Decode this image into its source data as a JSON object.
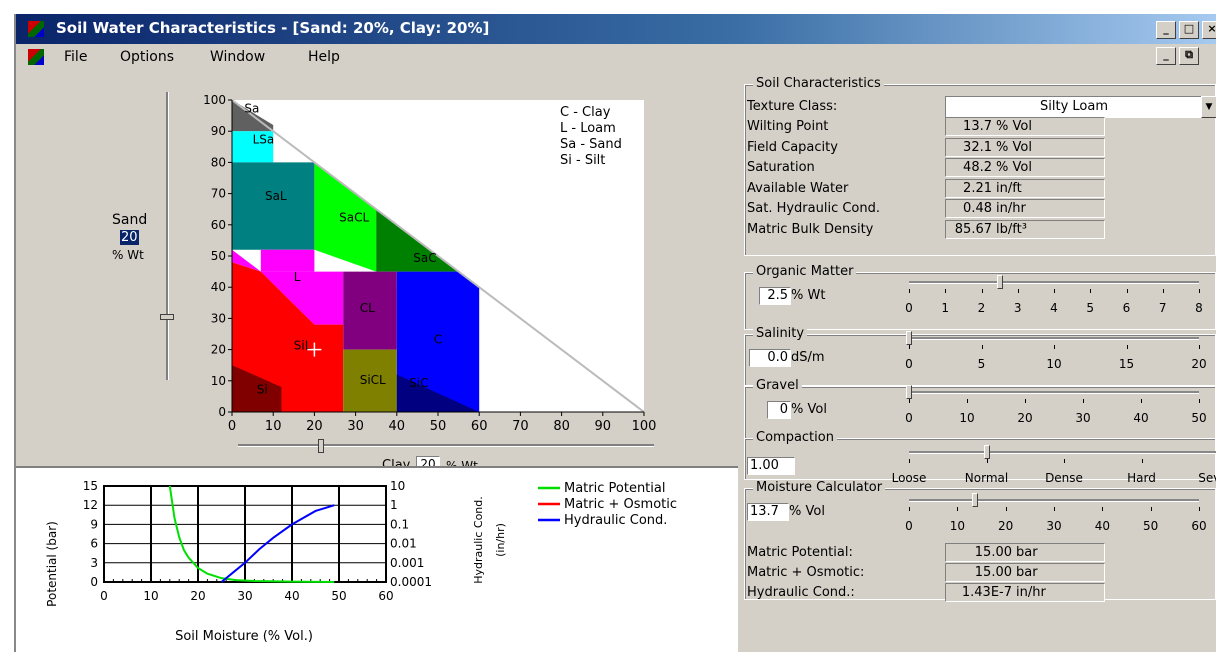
{
  "window": {
    "title": "Soil Water Characteristics  - [Sand: 20%, Clay: 20%]",
    "min": "_",
    "max": "□",
    "close": "×",
    "restore": "⧉"
  },
  "menu": [
    "File",
    "Options",
    "Window",
    "Help"
  ],
  "triangle": {
    "sand_label": "Sand",
    "sand_value": "20",
    "sand_unit": "% Wt",
    "clay_label": "Clay",
    "clay_value": "20",
    "clay_unit": "% Wt",
    "y_ticks": [
      "100",
      "90",
      "80",
      "70",
      "60",
      "50",
      "40",
      "30",
      "20",
      "10",
      "0"
    ],
    "x_ticks": [
      "0",
      "10",
      "20",
      "30",
      "40",
      "50",
      "60",
      "70",
      "80",
      "90",
      "100"
    ],
    "legend": [
      "C - Clay",
      "L - Loam",
      "Sa - Sand",
      "Si - Silt"
    ],
    "regions": [
      {
        "label": "Sa",
        "color": "#606060"
      },
      {
        "label": "LSa",
        "color": "#00ffff"
      },
      {
        "label": "SaL",
        "color": "#008080"
      },
      {
        "label": "SaCL",
        "color": "#00ff00"
      },
      {
        "label": "SaC",
        "color": "#008000"
      },
      {
        "label": "L",
        "color": "#ff00ff"
      },
      {
        "label": "CL",
        "color": "#800080"
      },
      {
        "label": "C",
        "color": "#0000ff"
      },
      {
        "label": "SiL",
        "color": "#ff0000"
      },
      {
        "label": "SiCL",
        "color": "#808000"
      },
      {
        "label": "SiC",
        "color": "#000080"
      },
      {
        "label": "Si",
        "color": "#800000"
      }
    ]
  },
  "plot": {
    "ylabel": "Potential (bar)",
    "y_ticks": [
      "15",
      "12",
      "9",
      "6",
      "3",
      "0"
    ],
    "x_ticks": [
      "0",
      "10",
      "20",
      "30",
      "40",
      "50",
      "60"
    ],
    "xlabel": "Soil Moisture (% Vol.)",
    "y2_ticks": [
      "10",
      "1",
      "0.1",
      "0.01",
      "0.001",
      "0.0001"
    ],
    "y2label": "Hydraulic Cond.",
    "y2unit": "(in/hr)",
    "legend": [
      {
        "name": "Matric Potential",
        "color": "#00e000"
      },
      {
        "name": "Matric + Osmotic",
        "color": "#ff0000"
      },
      {
        "name": "Hydraulic Cond.",
        "color": "#0000ff"
      }
    ]
  },
  "chart_data": {
    "type": "line",
    "xlabel": "Soil Moisture (% Vol.)",
    "ylabel": "Potential (bar)",
    "y2label": "Hydraulic Cond.",
    "xlim": [
      0,
      60
    ],
    "ylim": [
      0,
      15
    ],
    "y2lim": [
      0.0001,
      10
    ],
    "y2scale": "log",
    "series": [
      {
        "name": "Matric Potential",
        "axis": "left",
        "x": [
          14,
          15,
          16,
          17,
          18,
          20,
          22,
          25,
          28,
          32,
          40,
          49
        ],
        "y": [
          15,
          10,
          7,
          5,
          3.8,
          2.2,
          1.3,
          0.6,
          0.3,
          0.15,
          0.05,
          0.0
        ]
      },
      {
        "name": "Hydraulic Cond.",
        "axis": "right",
        "x": [
          25,
          28,
          30,
          33,
          36,
          40,
          45,
          49
        ],
        "y": [
          0.0001,
          0.0004,
          0.001,
          0.005,
          0.02,
          0.1,
          0.5,
          1.0
        ]
      }
    ]
  },
  "soil": {
    "caption": "Soil Characteristics",
    "texture_label": "Texture Class:",
    "texture_value": "Silty Loam",
    "rows": [
      {
        "label": "Wilting Point",
        "value": "13.7",
        "unit": "% Vol"
      },
      {
        "label": "Field Capacity",
        "value": "32.1",
        "unit": "% Vol"
      },
      {
        "label": "Saturation",
        "value": "48.2",
        "unit": "% Vol"
      },
      {
        "label": "Available Water",
        "value": "2.21",
        "unit": "in/ft"
      },
      {
        "label": "Sat. Hydraulic Cond.",
        "value": "0.48",
        "unit": "in/hr"
      },
      {
        "label": "Matric Bulk Density",
        "value": "85.67",
        "unit": "lb/ft³"
      }
    ]
  },
  "organic": {
    "caption": "Organic Matter",
    "value": "2.5",
    "unit": "% Wt",
    "ticks": [
      "0",
      "1",
      "2",
      "3",
      "4",
      "5",
      "6",
      "7",
      "8"
    ],
    "level": 2.5,
    "max": 8
  },
  "salinity": {
    "caption": "Salinity",
    "value": "0.0",
    "unit": "dS/m",
    "ticks": [
      "0",
      "5",
      "10",
      "15",
      "20"
    ],
    "level": 0,
    "max": 20
  },
  "gravel": {
    "caption": "Gravel",
    "value": "0",
    "unit": "% Vol",
    "ticks": [
      "0",
      "10",
      "20",
      "30",
      "40",
      "50"
    ],
    "level": 0,
    "max": 50
  },
  "compaction": {
    "caption": "Compaction",
    "value": "1.00",
    "ticks": [
      "Loose",
      "Normal",
      "Dense",
      "Hard",
      "Severe"
    ],
    "level": 0.25
  },
  "moisture": {
    "caption": "Moisture Calculator",
    "value": "13.7",
    "unit": "% Vol",
    "ticks": [
      "0",
      "10",
      "20",
      "30",
      "40",
      "50",
      "60"
    ],
    "level": 13.7,
    "max": 60,
    "rows": [
      {
        "label": "Matric Potential:",
        "value": "15.00",
        "unit": "bar"
      },
      {
        "label": "Matric + Osmotic:",
        "value": "15.00",
        "unit": "bar"
      },
      {
        "label": "Hydraulic Cond.:",
        "value": "1.43E-7",
        "unit": "in/hr"
      }
    ]
  }
}
